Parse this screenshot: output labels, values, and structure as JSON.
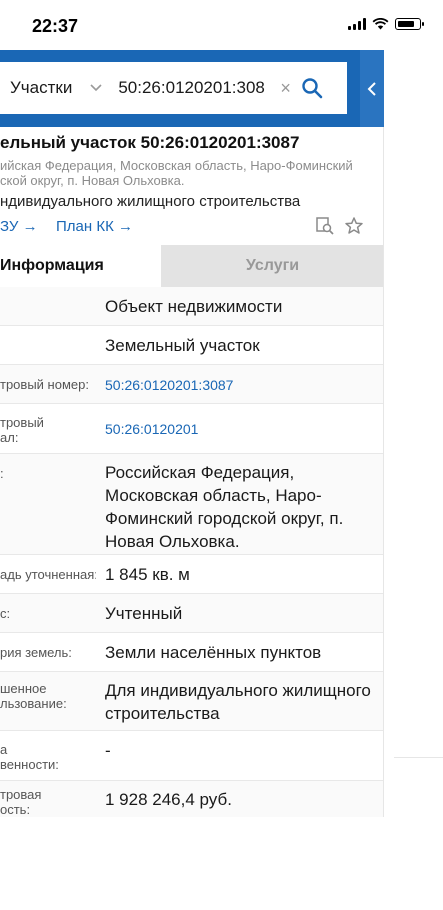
{
  "status_bar": {
    "time": "22:37",
    "battery_level": 0.8
  },
  "search": {
    "type_label": "Участки",
    "value": "50:26:0120201:308",
    "clear_symbol": "×"
  },
  "icons": {
    "search": "search-icon",
    "chevron": "chevron-down-icon",
    "collapse": "chevron-left-icon",
    "copy": "copy-search-icon",
    "favorite": "star-icon"
  },
  "colors": {
    "accent": "#1a67b5",
    "link": "#1a67b5",
    "tab_inactive_bg": "#e3e3e3"
  },
  "object": {
    "title": "ельный участок 50:26:0120201:3087",
    "address_line1": "ийская Федерация, Московская область, Наро-Фоминский",
    "address_line2": "ской округ, п. Новая Ольховка.",
    "purpose": "ндивидуального жилищного строительства",
    "link_zu": "ЗУ →",
    "link_plan": "План КК →"
  },
  "tabs": {
    "info": "Информация",
    "services": "Услуги"
  },
  "rows": [
    {
      "label": "",
      "value": "Объект недвижимости"
    },
    {
      "label": "",
      "value": "Земельный участок"
    },
    {
      "label": "тровый номер:",
      "value": "50:26:0120201:3087"
    },
    {
      "label": "тровый\nал:",
      "value": "50:26:0120201"
    },
    {
      "label": ":",
      "value": "Российская Федерация, Московская область, Наро-Фоминский городской округ, п. Новая Ольховка."
    },
    {
      "label": "адь уточненная:",
      "value": "1 845 кв. м"
    },
    {
      "label": "с:",
      "value": "Учтенный"
    },
    {
      "label": "рия земель:",
      "value": "Земли населённых пунктов"
    },
    {
      "label": "шенное\nльзование:",
      "value": "Для индивидуального жилищного строительства"
    },
    {
      "label": "а\nвенности:",
      "value": "-"
    },
    {
      "label": "тровая\nость:",
      "value": "1 928 246,4 руб."
    }
  ]
}
